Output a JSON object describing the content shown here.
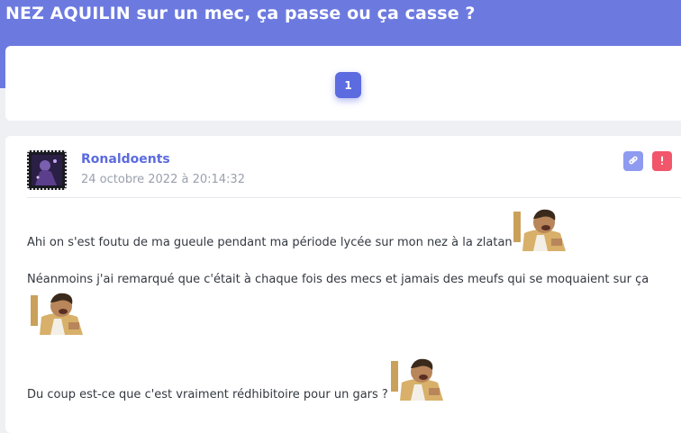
{
  "topic": {
    "title": "NEZ AQUILIN sur un mec, ça passe ou ça casse ?"
  },
  "pagination": {
    "pages": [
      "1"
    ],
    "current": "1"
  },
  "post": {
    "author": "Ronaldoents",
    "timestamp": "24 octobre 2022 à 20:14:32",
    "actions": {
      "link_icon": "link-icon",
      "report_icon": "alert-icon"
    },
    "lines": [
      "Ahi on s'est foutu de ma gueule pendant ma période lycée sur mon nez à la zlatan",
      "Néanmoins j'ai remarqué que c'était à chaque fois des mecs et jamais des meufs qui se moquaient sur ça",
      "Du coup est-ce que c'est vraiment rédhibitoire pour un gars ?"
    ],
    "sticker": "laughing-man-sticker"
  },
  "colors": {
    "accent": "#5c6bdf",
    "band": "#6c7ae0",
    "report": "#f2566b",
    "link": "#8e9bf0"
  }
}
